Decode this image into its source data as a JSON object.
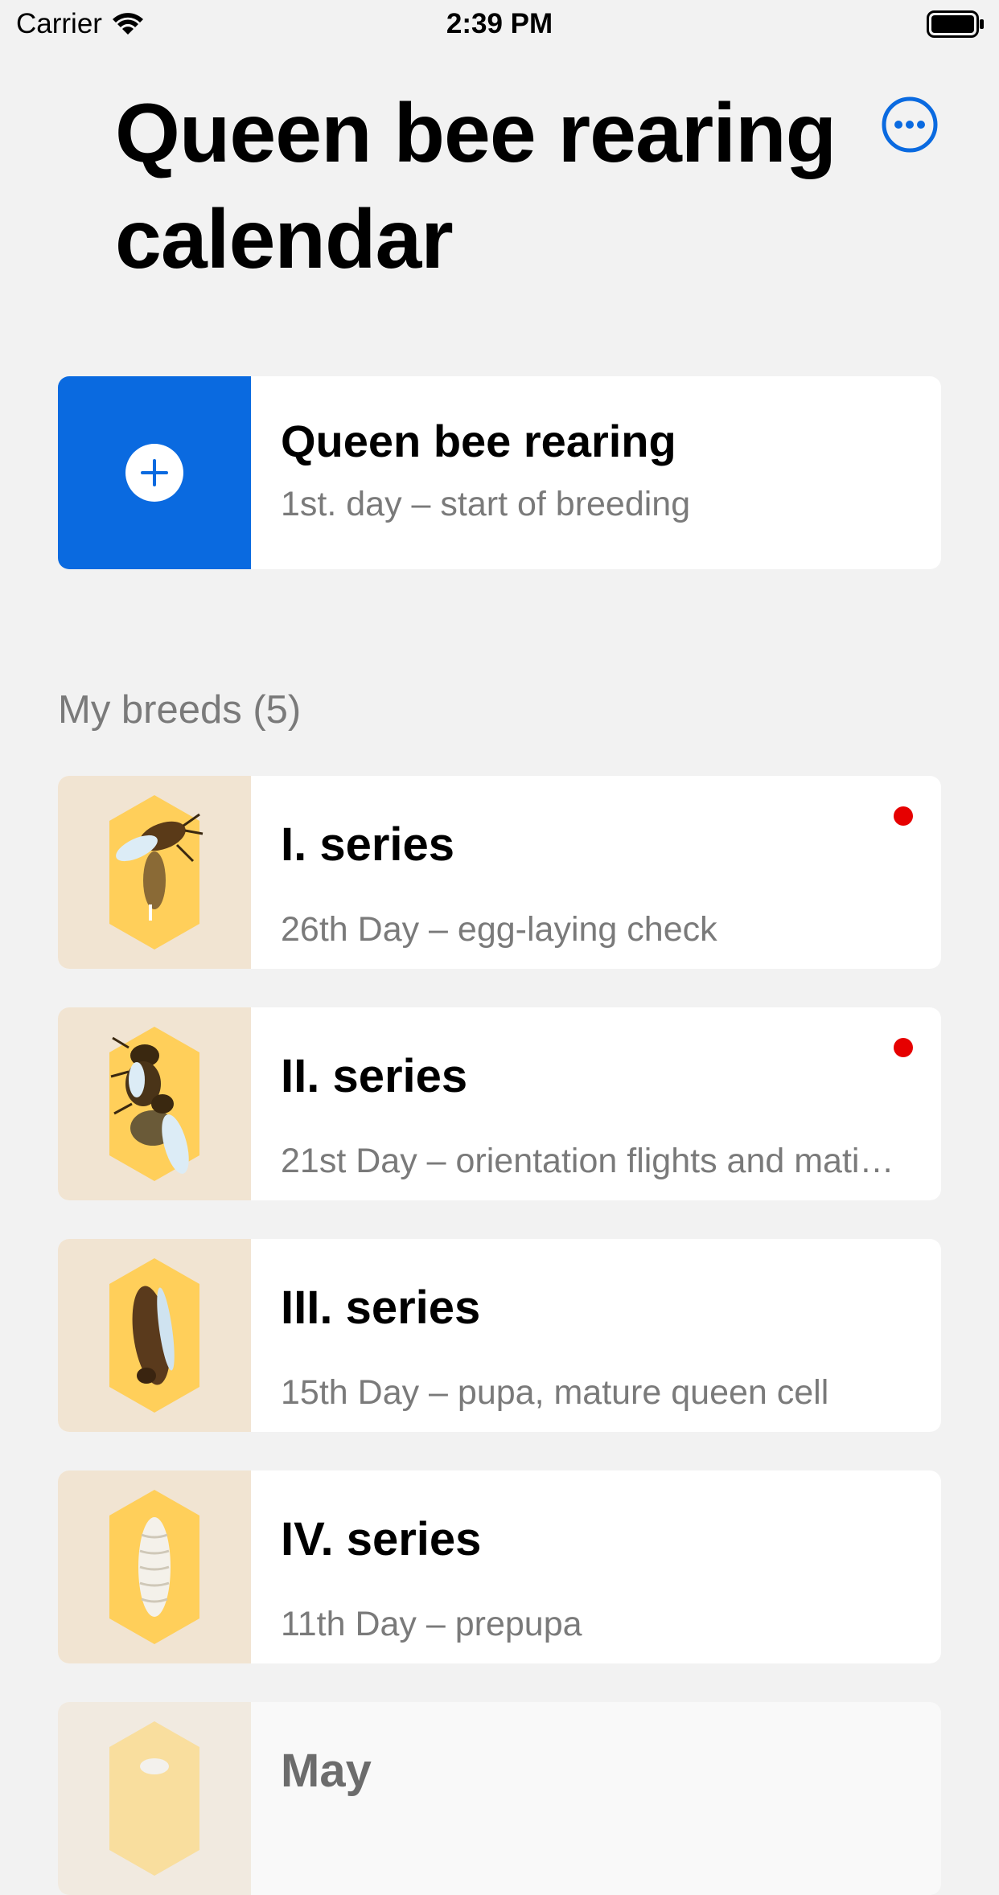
{
  "status_bar": {
    "carrier": "Carrier",
    "time": "2:39 PM"
  },
  "header": {
    "title": "Queen bee rearing calendar",
    "more_icon": "ellipsis-circle-icon"
  },
  "add_card": {
    "title": "Queen bee rearing",
    "subtitle": "1st. day – start of breeding",
    "icon": "plus-circle-icon",
    "accent": "#0a6ae0"
  },
  "breeds": {
    "header": "My breeds (5)",
    "items": [
      {
        "title": "I. series",
        "subtitle": "26th Day – egg-laying check",
        "new": true,
        "icon": "adult-queen-bee-icon"
      },
      {
        "title": "II. series",
        "subtitle": "21st Day – orientation flights and mati…",
        "new": true,
        "icon": "emerging-queens-icon"
      },
      {
        "title": "III. series",
        "subtitle": "15th Day – pupa, mature queen cell",
        "new": false,
        "icon": "pupa-icon"
      },
      {
        "title": "IV. series",
        "subtitle": "11th Day – prepupa",
        "new": false,
        "icon": "prepupa-icon"
      },
      {
        "title": "May",
        "subtitle": "",
        "new": false,
        "icon": "larva-icon"
      }
    ]
  },
  "colors": {
    "background": "#f2f2f2",
    "thumb": "#f1e4d2",
    "hex_cell": "#ffcf5a",
    "notification": "#e60000"
  }
}
